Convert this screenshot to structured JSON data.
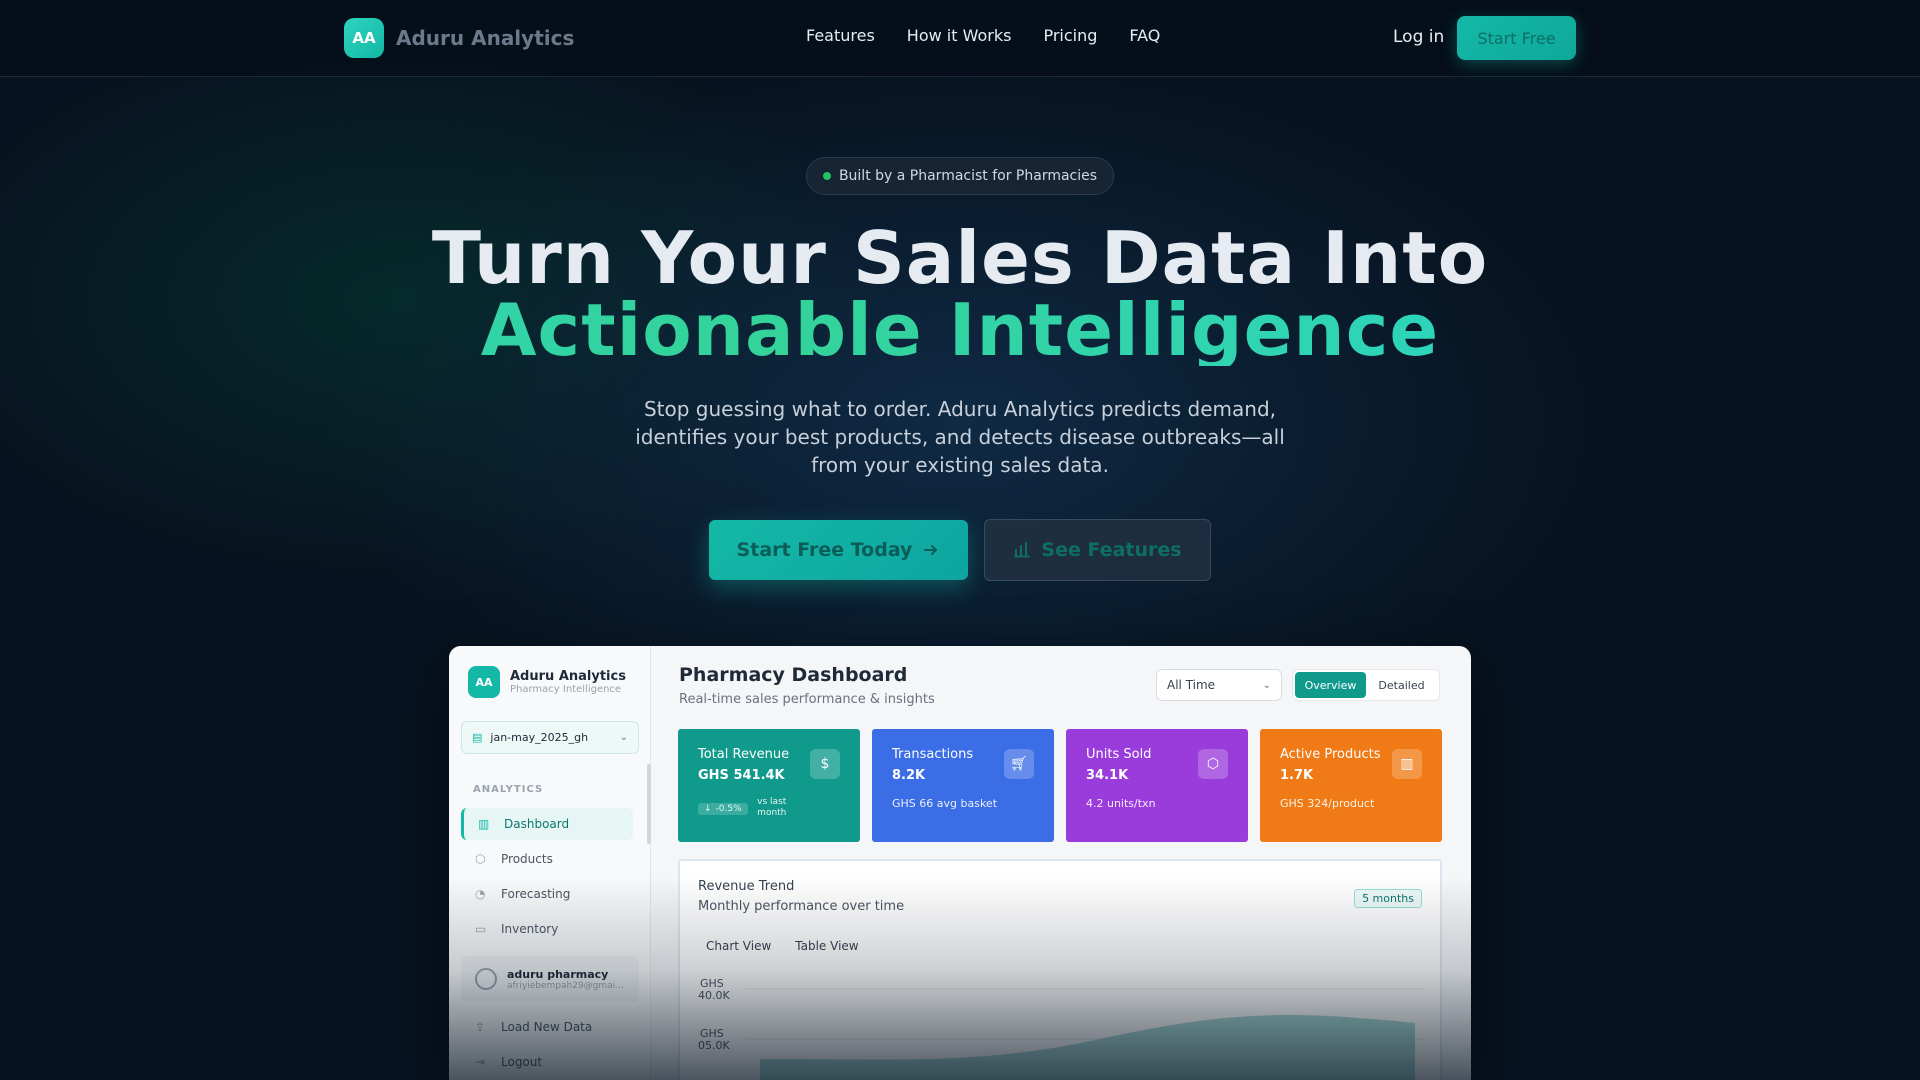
{
  "nav": {
    "logo_initials": "AA",
    "brand": "Aduru Analytics",
    "links": [
      "Features",
      "How it Works",
      "Pricing",
      "FAQ"
    ],
    "login": "Log in",
    "start_free": "Start Free"
  },
  "hero": {
    "pill": "Built by a Pharmacist for Pharmacies",
    "headline_line1": "Turn Your Sales Data Into",
    "headline_line2": "Actionable Intelligence",
    "subhead": "Stop guessing what to order. Aduru Analytics predicts demand, identifies your best products, and detects disease outbreaks—all from your existing sales data.",
    "cta_primary": "Start Free Today",
    "cta_secondary": "See Features"
  },
  "dashboard": {
    "sidebar": {
      "logo_initials": "AA",
      "brand": "Aduru Analytics",
      "brand_sub": "Pharmacy Intelligence",
      "dataset": "jan-may_2025_gh",
      "section": "ANALYTICS",
      "items": [
        "Dashboard",
        "Products",
        "Forecasting",
        "Inventory"
      ],
      "user_name": "aduru pharmacy",
      "user_email": "afriyiebempah29@gmai...",
      "load_data": "Load New Data",
      "logout": "Logout"
    },
    "title": "Pharmacy Dashboard",
    "subtitle": "Real-time sales performance & insights",
    "range": "All Time",
    "toggle": [
      "Overview",
      "Detailed"
    ],
    "kpis": [
      {
        "label": "Total Revenue",
        "value": "GHS 541.4K",
        "badge": "-0.5%",
        "vs": "vs last month",
        "color": "#0f9a8c",
        "icon": "dollar-icon"
      },
      {
        "label": "Transactions",
        "value": "8.2K",
        "foot": "GHS 66 avg basket",
        "color": "#3b6de6",
        "icon": "cart-icon"
      },
      {
        "label": "Units Sold",
        "value": "34.1K",
        "foot": "4.2 units/txn",
        "color": "#9a3cdc",
        "icon": "box-icon"
      },
      {
        "label": "Active Products",
        "value": "1.7K",
        "foot": "GHS 324/product",
        "color": "#f07a16",
        "icon": "bar-chart-icon"
      }
    ],
    "chart": {
      "title": "Revenue Trend",
      "subtitle": "Monthly performance over time",
      "badge": "5 months",
      "tabs": [
        "Chart View",
        "Table View"
      ],
      "y_ticks": [
        "GHS 40.0K",
        "GHS 05.0K"
      ]
    }
  }
}
